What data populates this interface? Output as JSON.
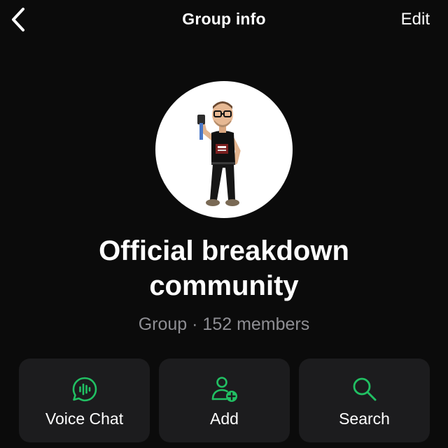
{
  "nav": {
    "title": "Group info",
    "edit_label": "Edit"
  },
  "group": {
    "name_line1": "Official breakdown",
    "name_line2": "community",
    "subtitle": "Group · 152 members"
  },
  "actions": [
    {
      "label": "Voice Chat",
      "icon": "voice-chat-icon"
    },
    {
      "label": "Add",
      "icon": "add-person-icon"
    },
    {
      "label": "Search",
      "icon": "search-icon"
    }
  ],
  "colors": {
    "background": "#0b0b0b",
    "card": "#1c1c1e",
    "accent_green": "#21c063",
    "secondary_text": "#8e8e93"
  }
}
